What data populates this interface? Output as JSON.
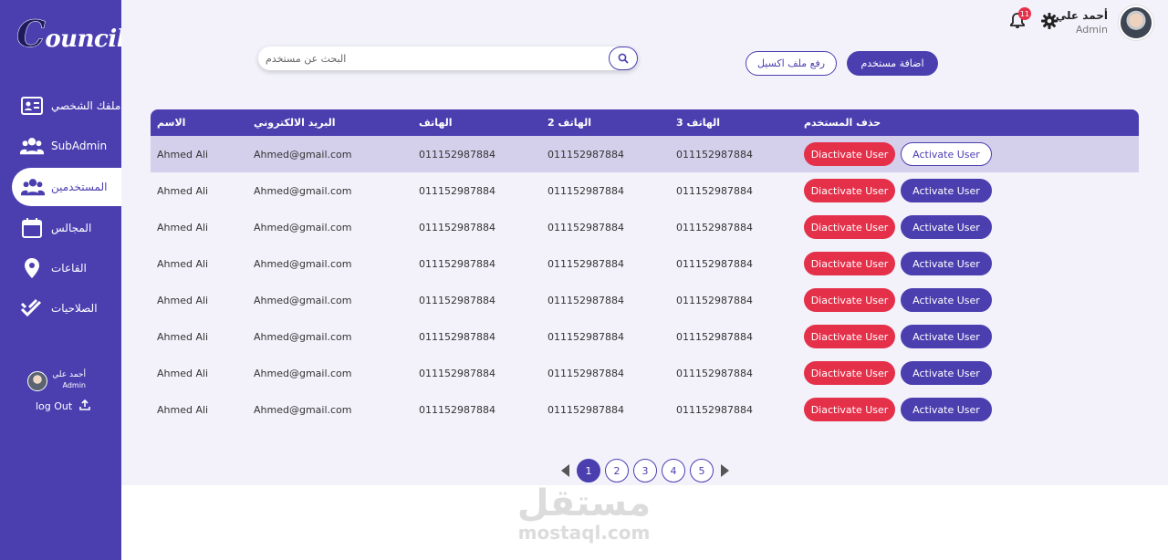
{
  "brand": {
    "logo_initial": "C",
    "logo_rest": "ouncils"
  },
  "sidebar": {
    "items": [
      {
        "label": "ملفك الشخصي",
        "icon": "id-card-icon"
      },
      {
        "label": "SubAdmin",
        "icon": "users-group-icon"
      },
      {
        "label": "المستخدمين",
        "icon": "users-icon"
      },
      {
        "label": "المجالس",
        "icon": "calendar-icon"
      },
      {
        "label": "القاعات",
        "icon": "map-pin-icon"
      },
      {
        "label": "الصلاحيات",
        "icon": "double-check-icon"
      }
    ],
    "active_index": 2,
    "user": {
      "name": "أحمد علي",
      "role": "Admin"
    },
    "logout_label": "log Out"
  },
  "header": {
    "user_name": "أحمد علي",
    "user_role": "Admin",
    "notification_count": "11"
  },
  "toolbar": {
    "search_placeholder": "البحث عن مستخدم",
    "upload_excel_label": "رفع ملف اكسيل",
    "add_user_label": "اضافة مستخدم"
  },
  "table": {
    "headers": {
      "name": "الاسم",
      "email": "البريد الالكتروني",
      "phone1": "الهاتف",
      "phone2": "الهاتف 2",
      "phone3": "الهاتف 3",
      "delete": "حذف المستخدم"
    },
    "deactivate_label": "Diactivate User",
    "activate_label": "Activate User",
    "rows": [
      {
        "name": "Ahmed Ali",
        "email": "Ahmed@gmail.com",
        "phone1": "011152987884",
        "phone2": "011152987884",
        "phone3": "011152987884"
      },
      {
        "name": "Ahmed Ali",
        "email": "Ahmed@gmail.com",
        "phone1": "011152987884",
        "phone2": "011152987884",
        "phone3": "011152987884"
      },
      {
        "name": "Ahmed Ali",
        "email": "Ahmed@gmail.com",
        "phone1": "011152987884",
        "phone2": "011152987884",
        "phone3": "011152987884"
      },
      {
        "name": "Ahmed Ali",
        "email": "Ahmed@gmail.com",
        "phone1": "011152987884",
        "phone2": "011152987884",
        "phone3": "011152987884"
      },
      {
        "name": "Ahmed Ali",
        "email": "Ahmed@gmail.com",
        "phone1": "011152987884",
        "phone2": "011152987884",
        "phone3": "011152987884"
      },
      {
        "name": "Ahmed Ali",
        "email": "Ahmed@gmail.com",
        "phone1": "011152987884",
        "phone2": "011152987884",
        "phone3": "011152987884"
      },
      {
        "name": "Ahmed Ali",
        "email": "Ahmed@gmail.com",
        "phone1": "011152987884",
        "phone2": "011152987884",
        "phone3": "011152987884"
      },
      {
        "name": "Ahmed Ali",
        "email": "Ahmed@gmail.com",
        "phone1": "011152987884",
        "phone2": "011152987884",
        "phone3": "011152987884"
      }
    ]
  },
  "pagination": {
    "pages": [
      "1",
      "2",
      "3",
      "4",
      "5"
    ],
    "current": "1"
  },
  "watermark": {
    "arabic": "مستقل",
    "latin": "mostaql.com"
  },
  "colors": {
    "primary": "#4b3fb0",
    "danger": "#e5304a",
    "selected_row": "#d4d0ec",
    "background": "#f3f2fb"
  }
}
